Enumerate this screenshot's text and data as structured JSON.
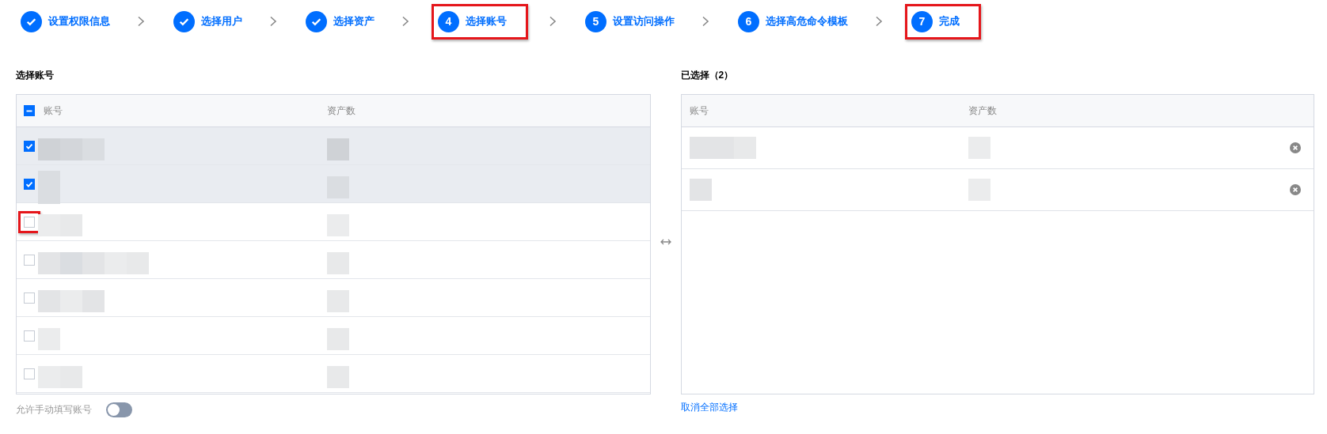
{
  "steps": [
    {
      "label": "设置权限信息",
      "done": true,
      "highlight": false
    },
    {
      "label": "选择用户",
      "done": true,
      "highlight": false
    },
    {
      "label": "选择资产",
      "done": true,
      "highlight": false
    },
    {
      "label": "选择账号",
      "number": "4",
      "done": false,
      "highlight": true
    },
    {
      "label": "设置访问操作",
      "number": "5",
      "done": false,
      "highlight": false
    },
    {
      "label": "选择高危命令模板",
      "number": "6",
      "done": false,
      "highlight": false
    },
    {
      "label": "完成",
      "number": "7",
      "done": false,
      "highlight": true
    }
  ],
  "account_panel": {
    "title": "选择账号",
    "columns": [
      "账号",
      "资产数"
    ],
    "select_all_partial": true,
    "rows": [
      {
        "checked": true,
        "highlight": false
      },
      {
        "checked": true,
        "highlight": false
      },
      {
        "checked": false,
        "highlight": true
      },
      {
        "checked": false,
        "highlight": false
      },
      {
        "checked": false,
        "highlight": false
      },
      {
        "checked": false,
        "highlight": false
      },
      {
        "checked": false,
        "highlight": false
      }
    ],
    "manual_toggle": {
      "label": "允许手动填写账号",
      "on": false
    }
  },
  "selected_panel": {
    "title": "已选择（2）",
    "columns": [
      "账号",
      "资产数"
    ],
    "rows": [
      {
        "kind": "row"
      },
      {
        "kind": "row"
      }
    ],
    "clear_link": "取消全部选择"
  }
}
